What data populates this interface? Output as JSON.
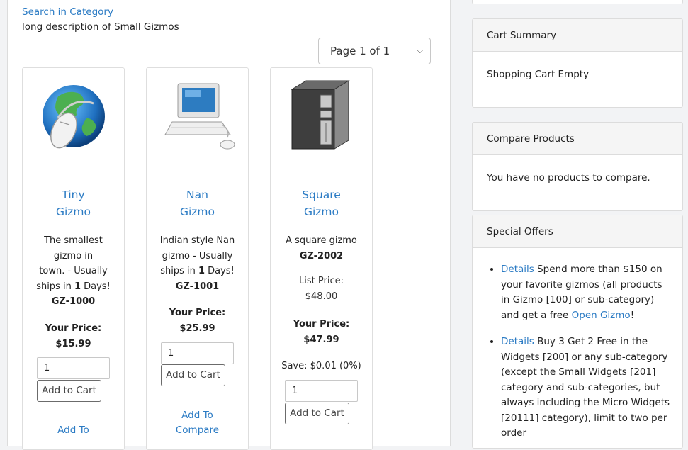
{
  "category": {
    "search_link": "Search in Category",
    "description": "long description of Small Gizmos",
    "pager": "Page 1 of 1"
  },
  "products": [
    {
      "name_line1": "Tiny",
      "name_line2": "Gizmo",
      "desc_lines": [
        "The smallest",
        "gizmo in",
        "town. - Usually"
      ],
      "ships_pre": "ships in ",
      "ships_num": "1",
      "ships_post": " Days!",
      "sku": "GZ-1000",
      "your_price_label": "Your Price:",
      "your_price": "$15.99",
      "qty": "1",
      "add_label": "Add to Cart",
      "compare_label": "Add To"
    },
    {
      "name_line1": "Nan",
      "name_line2": "Gizmo",
      "desc_lines": [
        "Indian style Nan",
        "gizmo - Usually"
      ],
      "ships_pre": "ships in ",
      "ships_num": "1",
      "ships_post": " Days!",
      "sku": "GZ-1001",
      "your_price_label": "Your Price:",
      "your_price": "$25.99",
      "qty": "1",
      "add_label": "Add to Cart",
      "compare_line1": "Add To",
      "compare_line2": "Compare"
    },
    {
      "name_line1": "Square",
      "name_line2": "Gizmo",
      "desc_lines": [
        "A square gizmo"
      ],
      "sku": "GZ-2002",
      "list_price_label": "List Price:",
      "list_price": "$48.00",
      "your_price_label": "Your Price:",
      "your_price": "$47.99",
      "save": "Save: $0.01 (0%)",
      "qty": "1",
      "add_label": "Add to Cart"
    }
  ],
  "sidebar": {
    "cart": {
      "title": "Cart Summary",
      "body": "Shopping Cart Empty"
    },
    "compare": {
      "title": "Compare Products",
      "body": "You have no products to compare."
    },
    "offers": {
      "title": "Special Offers",
      "items": [
        {
          "link": "Details",
          "text": " Spend more than $150 on your favorite gizmos (all products in Gizmo [100] or sub-category) and get a free ",
          "link2": "Open Gizmo",
          "tail": "!"
        },
        {
          "link": "Details",
          "text": " Buy 3 Get 2 Free in the Widgets [200] or any sub-category (except the Small Widgets [201] category and sub-categories, but always including the Micro Widgets [20111] category), limit to two per order"
        }
      ]
    }
  }
}
